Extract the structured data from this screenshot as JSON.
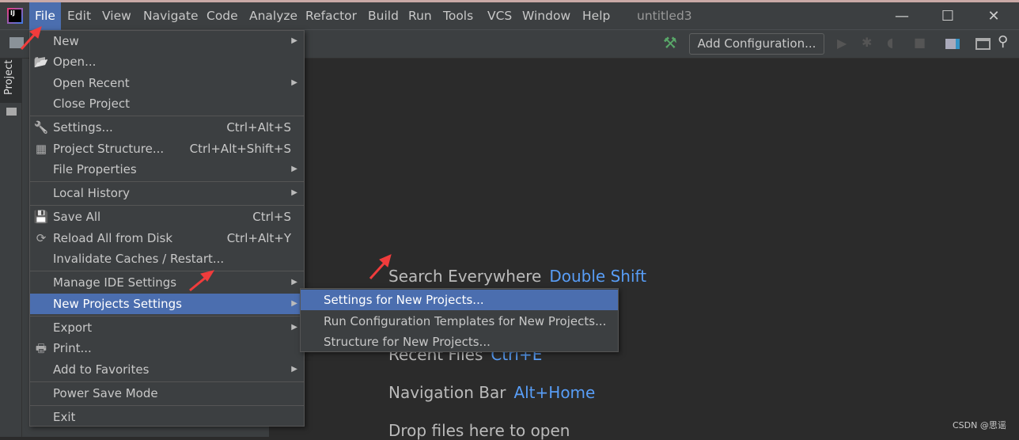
{
  "window": {
    "title": "untitled3",
    "minimize": "—",
    "maximize": "☐",
    "close": "✕"
  },
  "menubar": [
    "File",
    "Edit",
    "View",
    "Navigate",
    "Code",
    "Analyze",
    "Refactor",
    "Build",
    "Run",
    "Tools",
    "VCS",
    "Window",
    "Help"
  ],
  "toolbar": {
    "add_configuration": "Add Configuration..."
  },
  "sidebar": {
    "project_tab": "Project"
  },
  "file_menu": [
    {
      "label": "New",
      "submenu": true
    },
    {
      "label": "Open...",
      "icon": "folder-open-icon"
    },
    {
      "label": "Open Recent",
      "submenu": true
    },
    {
      "label": "Close Project"
    },
    {
      "sep": true
    },
    {
      "label": "Settings...",
      "shortcut": "Ctrl+Alt+S",
      "icon": "wrench-icon"
    },
    {
      "label": "Project Structure...",
      "shortcut": "Ctrl+Alt+Shift+S",
      "icon": "project-structure-icon"
    },
    {
      "label": "File Properties",
      "submenu": true
    },
    {
      "sep": true
    },
    {
      "label": "Local History",
      "submenu": true
    },
    {
      "sep": true
    },
    {
      "label": "Save All",
      "shortcut": "Ctrl+S",
      "icon": "save-icon"
    },
    {
      "label": "Reload All from Disk",
      "shortcut": "Ctrl+Alt+Y",
      "icon": "reload-icon"
    },
    {
      "label": "Invalidate Caches / Restart..."
    },
    {
      "sep": true
    },
    {
      "label": "Manage IDE Settings",
      "submenu": true
    },
    {
      "label": "New Projects Settings",
      "submenu": true,
      "highlighted": true
    },
    {
      "sep": true
    },
    {
      "label": "Export",
      "submenu": true
    },
    {
      "label": "Print...",
      "icon": "print-icon"
    },
    {
      "label": "Add to Favorites",
      "submenu": true
    },
    {
      "sep": true
    },
    {
      "label": "Power Save Mode"
    },
    {
      "sep": true
    },
    {
      "label": "Exit"
    }
  ],
  "submenu": [
    {
      "label": "Settings for New Projects...",
      "highlighted": true
    },
    {
      "label": "Run Configuration Templates for New Projects..."
    },
    {
      "label": "Structure for New Projects..."
    }
  ],
  "welcome": [
    {
      "label": "Search Everywhere",
      "key": "Double Shift"
    },
    {
      "label": "Recent Files",
      "key": "Ctrl+E"
    },
    {
      "label": "Navigation Bar",
      "key": "Alt+Home"
    },
    {
      "label": "Drop files here to open",
      "key": ""
    }
  ],
  "watermark": "CSDN @思谣",
  "colors": {
    "accent": "#4b6eaf",
    "shortcut": "#589df6",
    "annotation_arrow": "#f03c3c"
  }
}
